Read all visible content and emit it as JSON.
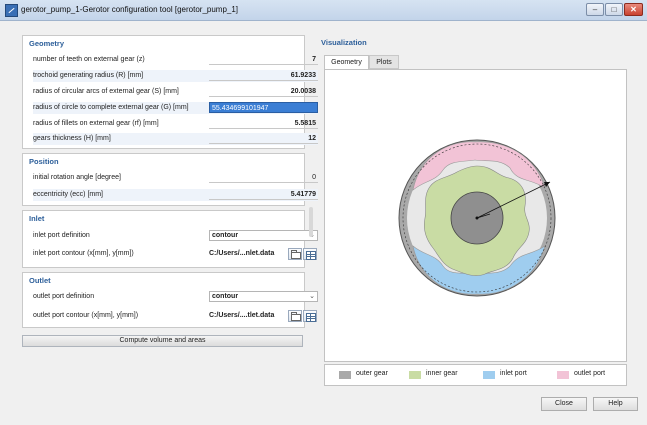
{
  "window": {
    "title": "gerotor_pump_1-Gerotor configuration tool [gerotor_pump_1]",
    "min_icon": "minimize-icon",
    "max_icon": "maximize-icon",
    "close_icon": "close-icon"
  },
  "geometry": {
    "title": "Geometry",
    "rows": [
      {
        "label": "number of teeth on external gear (z)",
        "value": "7"
      },
      {
        "label": "trochoid generating radius (R) [mm]",
        "value": "61.9233"
      },
      {
        "label": "radius of circular arcs of external gear (S) [mm]",
        "value": "20.0038"
      },
      {
        "label": "radius of circle to complete external gear (G) [mm]",
        "value": "55.434699101947"
      },
      {
        "label": "radius of fillets on external gear (rf) [mm]",
        "value": "5.5815"
      },
      {
        "label": "gears thickness (H) [mm]",
        "value": "12"
      }
    ]
  },
  "position": {
    "title": "Position",
    "rows": [
      {
        "label": "initial rotation angle [degree]",
        "value": "0"
      },
      {
        "label": "eccentricity (ecc) [mm]",
        "value": "5.41779"
      }
    ]
  },
  "inlet": {
    "title": "Inlet",
    "definition_label": "inlet port definition",
    "definition_value": "contour",
    "contour_label": "inlet port contour (x[mm], y[mm])",
    "contour_value": "C:/Users/...nlet.data"
  },
  "outlet": {
    "title": "Outlet",
    "definition_label": "outlet port definition",
    "definition_value": "contour",
    "contour_label": "outlet port contour (x[mm], y[mm])",
    "contour_value": "C:/Users/....tlet.data"
  },
  "compute_button": "Compute volume and areas",
  "visualization": {
    "title": "Visualization",
    "tabs": [
      "Geometry",
      "Plots"
    ],
    "active_tab": "Geometry",
    "legend": [
      {
        "label": "outer gear",
        "color": "#a9a9a9"
      },
      {
        "label": "inner gear",
        "color": "#c9dca4"
      },
      {
        "label": "inlet port",
        "color": "#9fcdef"
      },
      {
        "label": "outlet port",
        "color": "#f2c3d6"
      }
    ]
  },
  "buttons": {
    "close": "Close",
    "help": "Help"
  },
  "colors": {
    "section_title": "#2d5f9a",
    "selection": "#3b7ed4",
    "outer_gear": "#a9a9a9",
    "inner_gear": "#c9dca4",
    "inlet_port": "#9fcdef",
    "outlet_port": "#f2c3d6"
  }
}
